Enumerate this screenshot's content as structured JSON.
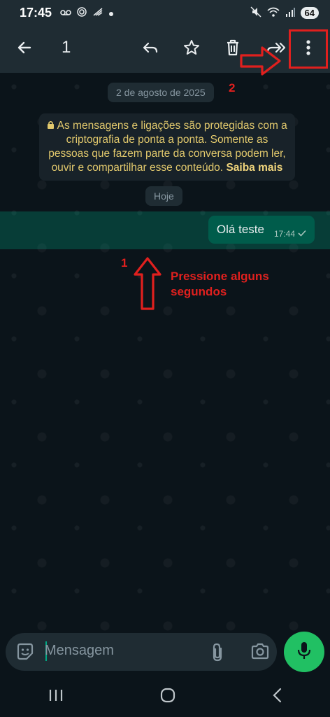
{
  "status": {
    "time": "17:45",
    "battery": "64",
    "left_icons": [
      "voicemail-icon",
      "nfc-icon",
      "signal-sync-icon",
      "dot-icon"
    ],
    "right_icons": [
      "mute-icon",
      "wifi-icon",
      "cell-signal-icon"
    ]
  },
  "toolbar": {
    "selected_count": "1",
    "icons": [
      "back-arrow-icon",
      "reply-icon",
      "star-icon",
      "delete-icon",
      "forward-icon",
      "more-vert-icon"
    ]
  },
  "chat": {
    "date_label": "2 de agosto de 2025",
    "encryption_text": "As mensagens e ligações são protegidas com a criptografia de ponta a ponta. Somente as pessoas que fazem parte da conversa podem ler, ouvir e compartilhar esse conteúdo.",
    "encryption_link": "Saiba mais",
    "today_label": "Hoje",
    "message": {
      "text": "Olá teste",
      "time": "17:44"
    }
  },
  "annotations": {
    "step1_number": "1",
    "step1_text": "Pressione alguns segundos",
    "step2_number": "2",
    "color": "#e0201e"
  },
  "composer": {
    "placeholder": "Mensagem"
  },
  "colors": {
    "background": "#0b141a",
    "bar": "#1f2c33",
    "bubble": "#005c4b",
    "accent": "#21c063"
  }
}
